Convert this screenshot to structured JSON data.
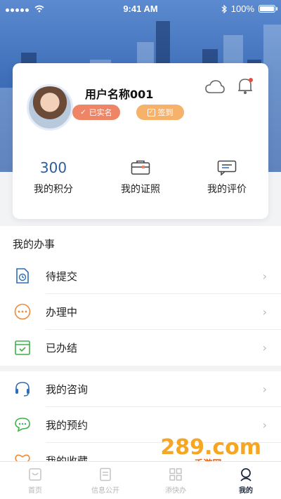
{
  "status_bar": {
    "time": "9:41 AM",
    "battery": "100%"
  },
  "profile": {
    "username": "用户名称001",
    "verified_badge": "已实名",
    "sign_in_button": "签到"
  },
  "stats": [
    {
      "value": "300",
      "label": "我的积分"
    },
    {
      "label": "我的证照",
      "icon": "wallet-icon"
    },
    {
      "label": "我的评价",
      "icon": "comment-icon"
    }
  ],
  "my_affairs": {
    "title": "我的办事",
    "items": [
      {
        "label": "待提交",
        "icon": "clock-document-icon",
        "color": "#2f6db5"
      },
      {
        "label": "办理中",
        "icon": "more-circle-icon",
        "color": "#ee8a3a"
      },
      {
        "label": "已办结",
        "icon": "calendar-check-icon",
        "color": "#3fb04a"
      }
    ]
  },
  "services": {
    "items": [
      {
        "label": "我的咨询",
        "icon": "headset-icon",
        "color": "#2f6db5"
      },
      {
        "label": "我的预约",
        "icon": "chat-icon",
        "color": "#3fb04a"
      },
      {
        "label": "我的收藏",
        "icon": "heart-icon",
        "color": "#ee8a3a"
      }
    ]
  },
  "tab_bar": {
    "items": [
      {
        "label": "首页",
        "icon": "home-icon"
      },
      {
        "label": "信息公开",
        "icon": "document-icon"
      },
      {
        "label": "添快办",
        "icon": "grid-icon"
      },
      {
        "label": "我的",
        "icon": "user-icon",
        "active": true
      }
    ]
  },
  "watermark": {
    "text": "289.com",
    "sub": "手游网"
  }
}
